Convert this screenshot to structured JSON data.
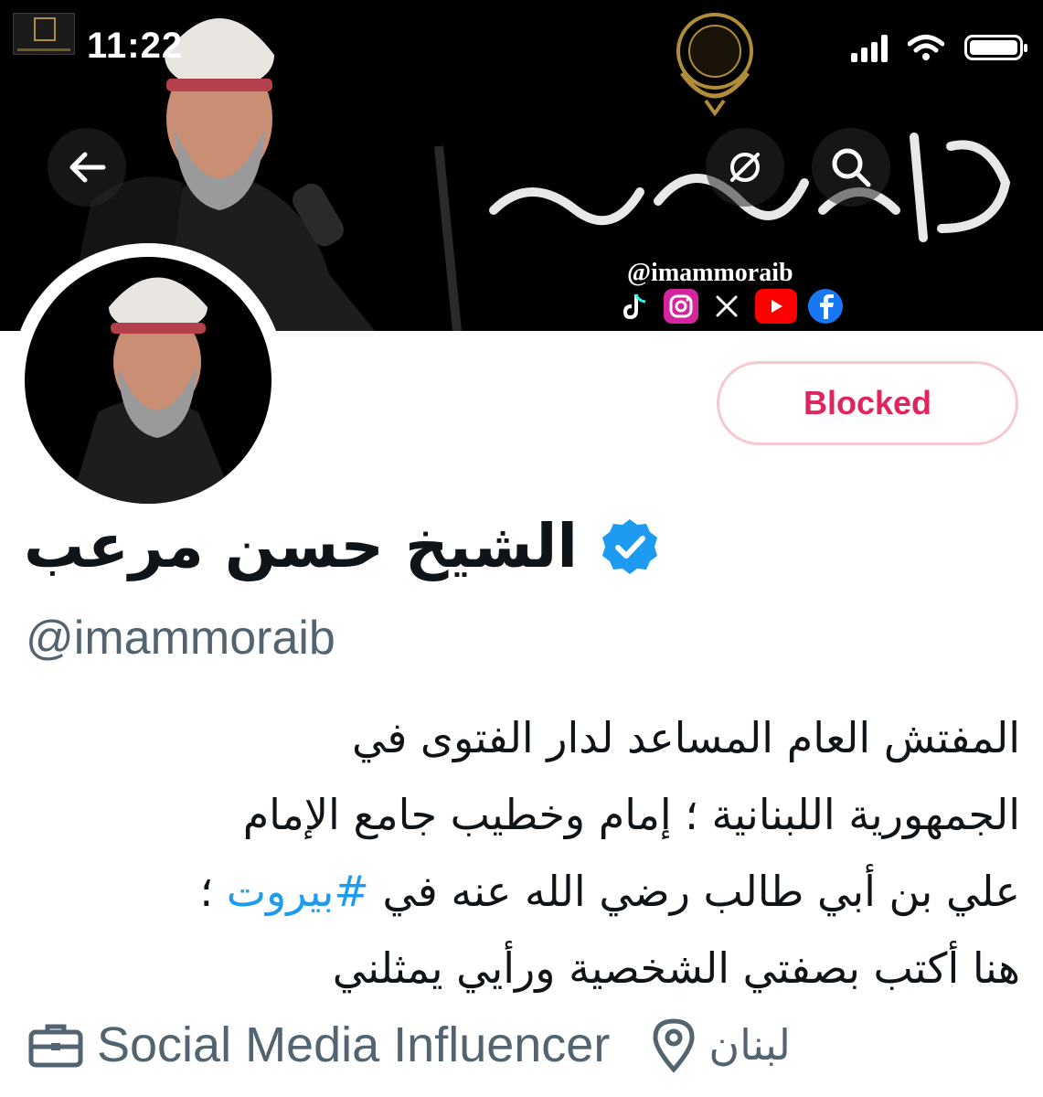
{
  "status_bar": {
    "time": "11:22",
    "icons": [
      "cellular-signal-icon",
      "wifi-icon",
      "battery-icon"
    ]
  },
  "header": {
    "back_icon": "arrow-left-icon",
    "share_icon": "share-icon",
    "search_icon": "search-icon",
    "banner": {
      "calligraphy_text": "الشيخ حسن مرعب",
      "handle": "@imammoraib",
      "social_icons": [
        "tiktok-icon",
        "instagram-icon",
        "x-icon",
        "youtube-icon",
        "facebook-icon"
      ]
    }
  },
  "profile": {
    "display_name": "الشيخ حسن مرعب",
    "verified_icon": "verified-badge-icon",
    "handle": "@imammoraib",
    "bio_lines": [
      "المفتش العام المساعد لدار الفتوى في",
      "الجمهورية اللبنانية ؛ إمام وخطيب جامع الإمام"
    ],
    "bio_line3_pre": "علي بن أبي طالب رضي الله عنه في ",
    "bio_hashtag": "#بيروت",
    "bio_line3_post": " ؛",
    "bio_line4": "هنا أكتب بصفتي الشخصية ورأيي يمثلني",
    "category": "Social Media Influencer",
    "location": "لبنان"
  },
  "actions": {
    "blocked_label": "Blocked"
  },
  "colors": {
    "blocked_red": "#e0245e",
    "blocked_border": "#f7c8cf",
    "link_blue": "#1d9bf0",
    "verified_blue": "#1d9bf0",
    "secondary_text": "#536471",
    "primary_text": "#0f1419"
  }
}
